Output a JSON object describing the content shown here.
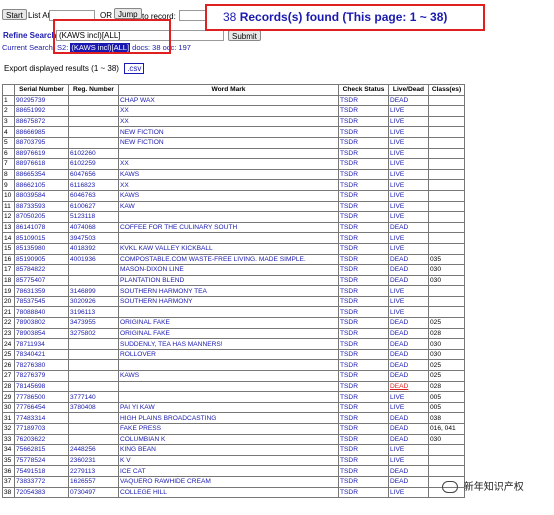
{
  "search": {
    "start_label": "Start",
    "list_at_label": "List At:",
    "list_at_value": "",
    "or_label": "OR",
    "jump_label": "Jump",
    "to_record_label": "to record:",
    "to_record_value": "",
    "refine_label": "Refine Search",
    "refine_value": "(KAWS incl)[ALL]",
    "submit_label": "Submit",
    "current_search_label": "Current Search:",
    "current_search_prefix": "S2:",
    "current_search_query": "(KAWS incl)[ALL]",
    "current_search_suffix": "docs: 38 occ: 197"
  },
  "records": {
    "count": "38",
    "text": "Records(s) found (This page: 1 ~ 38)"
  },
  "export": {
    "text": "Export displayed results (1 ~ 38)",
    "csv_label": ".csv"
  },
  "table": {
    "headers": [
      "",
      "Serial Number",
      "Reg. Number",
      "Word Mark",
      "Check Status",
      "Live/Dead",
      "Class(es)"
    ],
    "rows": [
      [
        "1",
        "90295739",
        "",
        "CHAP WAX",
        "TSDR",
        "DEAD",
        ""
      ],
      [
        "2",
        "88651992",
        "",
        "XX",
        "TSDR",
        "LIVE",
        ""
      ],
      [
        "3",
        "88675872",
        "",
        "XX",
        "TSDR",
        "LIVE",
        ""
      ],
      [
        "4",
        "88666985",
        "",
        "NEW FICTION",
        "TSDR",
        "LIVE",
        ""
      ],
      [
        "5",
        "88703795",
        "",
        "NEW FICTION",
        "TSDR",
        "LIVE",
        ""
      ],
      [
        "6",
        "88976619",
        "6102260",
        "",
        "TSDR",
        "LIVE",
        ""
      ],
      [
        "7",
        "88976618",
        "6102259",
        "XX",
        "TSDR",
        "LIVE",
        ""
      ],
      [
        "8",
        "88665354",
        "6047656",
        "KAWS",
        "TSDR",
        "LIVE",
        ""
      ],
      [
        "9",
        "88662105",
        "6116823",
        "XX",
        "TSDR",
        "LIVE",
        ""
      ],
      [
        "10",
        "88039584",
        "6046763",
        "KAWS",
        "TSDR",
        "LIVE",
        ""
      ],
      [
        "11",
        "88733593",
        "6100627",
        "KAW",
        "TSDR",
        "LIVE",
        ""
      ],
      [
        "12",
        "87050205",
        "5123118",
        "",
        "TSDR",
        "LIVE",
        ""
      ],
      [
        "13",
        "86141078",
        "4074068",
        "COFFEE FOR THE CULINARY SOUTH",
        "TSDR",
        "DEAD",
        ""
      ],
      [
        "14",
        "85109015",
        "3947503",
        "",
        "TSDR",
        "LIVE",
        ""
      ],
      [
        "15",
        "85135980",
        "4018392",
        "KVKL KAW VALLEY KICKBALL",
        "TSDR",
        "LIVE",
        ""
      ],
      [
        "16",
        "85190905",
        "4001936",
        "COMPOSTABLE.COM WASTE-FREE LIVING. MADE SIMPLE.",
        "TSDR",
        "DEAD",
        "035"
      ],
      [
        "17",
        "85784822",
        "",
        "MASON-DIXON LINE",
        "TSDR",
        "DEAD",
        "030"
      ],
      [
        "18",
        "85775407",
        "",
        "PLANTATION BLEND",
        "TSDR",
        "DEAD",
        "030"
      ],
      [
        "19",
        "78631359",
        "3146899",
        "SOUTHERN HARMONY TEA",
        "TSDR",
        "LIVE",
        ""
      ],
      [
        "20",
        "78537545",
        "3020926",
        "SOUTHERN HARMONY",
        "TSDR",
        "LIVE",
        ""
      ],
      [
        "21",
        "78088840",
        "3196113",
        "",
        "TSDR",
        "LIVE",
        ""
      ],
      [
        "22",
        "78903802",
        "3473955",
        "ORIGINAL FAKE",
        "TSDR",
        "DEAD",
        "025"
      ],
      [
        "23",
        "78903854",
        "3275802",
        "ORIGINAL FAKE",
        "TSDR",
        "DEAD",
        "028"
      ],
      [
        "24",
        "78711934",
        "",
        "SUDDENLY, TEA HAS MANNERS!",
        "TSDR",
        "DEAD",
        "030"
      ],
      [
        "25",
        "78340421",
        "",
        "ROLLOVER",
        "TSDR",
        "DEAD",
        "030"
      ],
      [
        "26",
        "78276380",
        "",
        "",
        "TSDR",
        "DEAD",
        "025"
      ],
      [
        "27",
        "78276379",
        "",
        "KAWS",
        "TSDR",
        "DEAD",
        "025"
      ],
      [
        "28",
        "78145698",
        "",
        "",
        "TSDR",
        "DEAD",
        "028"
      ],
      [
        "29",
        "77786500",
        "3777140",
        "",
        "TSDR",
        "LIVE",
        "005"
      ],
      [
        "30",
        "77766454",
        "3780408",
        "PAI YI KAW",
        "TSDR",
        "LIVE",
        "005"
      ],
      [
        "31",
        "77483314",
        "",
        "HIGH PLAINS BROADCASTING",
        "TSDR",
        "DEAD",
        "038"
      ],
      [
        "32",
        "77189703",
        "",
        "FAKE PRESS",
        "TSDR",
        "DEAD",
        "016, 041"
      ],
      [
        "33",
        "76203622",
        "",
        "COLUMBIAN K",
        "TSDR",
        "DEAD",
        "030"
      ],
      [
        "34",
        "75662815",
        "2448256",
        "KING BEAN",
        "TSDR",
        "LIVE",
        ""
      ],
      [
        "35",
        "75778524",
        "2360231",
        "K V",
        "TSDR",
        "LIVE",
        ""
      ],
      [
        "36",
        "75491518",
        "2279113",
        "ICE CAT",
        "TSDR",
        "DEAD",
        ""
      ],
      [
        "37",
        "73833772",
        "1626557",
        "VAQUERO RAWHIDE CREAM",
        "TSDR",
        "DEAD",
        ""
      ],
      [
        "38",
        "72054383",
        "0730497",
        "COLLEGE HILL",
        "TSDR",
        "LIVE",
        ""
      ]
    ]
  },
  "watermark": {
    "text": "新年知识产权"
  },
  "colors": {
    "link": "#1a1ab0",
    "highlight_box": "#e02020"
  }
}
